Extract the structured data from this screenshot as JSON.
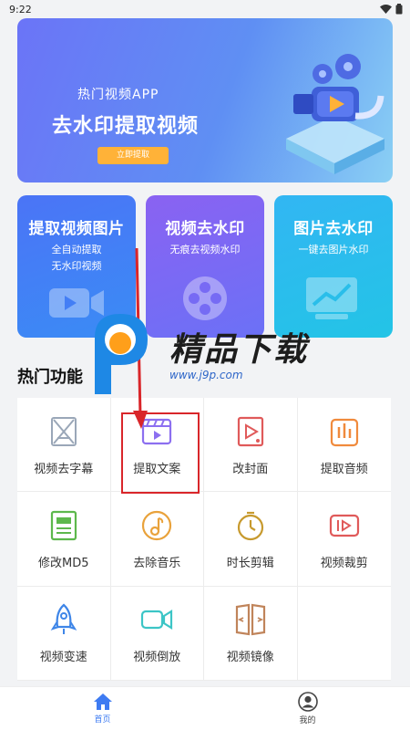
{
  "status_bar": {
    "time": "9:22"
  },
  "banner": {
    "title": "热门视频APP",
    "headline": "去水印提取视频",
    "cta_label": "立即提取"
  },
  "feature_cards": [
    {
      "title": "提取视频图片",
      "sub1": "全自动提取",
      "sub2": "无水印视频",
      "icon": "video-icon"
    },
    {
      "title": "视频去水印",
      "sub1": "无痕去视频水印",
      "sub2": "",
      "icon": "film-reel-icon"
    },
    {
      "title": "图片去水印",
      "sub1": "一键去图片水印",
      "sub2": "",
      "icon": "image-chart-icon"
    }
  ],
  "section": {
    "title": "热门功能"
  },
  "tools": [
    {
      "label": "视频去字幕",
      "icon": "remove-subtitle-icon"
    },
    {
      "label": "提取文案",
      "icon": "extract-text-icon"
    },
    {
      "label": "改封面",
      "icon": "change-cover-icon"
    },
    {
      "label": "提取音频",
      "icon": "extract-audio-icon"
    },
    {
      "label": "修改MD5",
      "icon": "md5-icon"
    },
    {
      "label": "去除音乐",
      "icon": "remove-music-icon"
    },
    {
      "label": "时长剪辑",
      "icon": "duration-clip-icon"
    },
    {
      "label": "视频裁剪",
      "icon": "video-crop-icon"
    },
    {
      "label": "视频变速",
      "icon": "speed-rocket-icon"
    },
    {
      "label": "视频倒放",
      "icon": "reverse-video-icon"
    },
    {
      "label": "视频镜像",
      "icon": "mirror-icon"
    }
  ],
  "watermark": {
    "main": "精品下载",
    "url": "www.j9p.com"
  },
  "tabbar": {
    "home_label": "首页",
    "mine_label": "我的"
  },
  "colors": {
    "accent": "#3e7bf2",
    "highlight": "#d9262a",
    "cta": "#ffb238"
  }
}
